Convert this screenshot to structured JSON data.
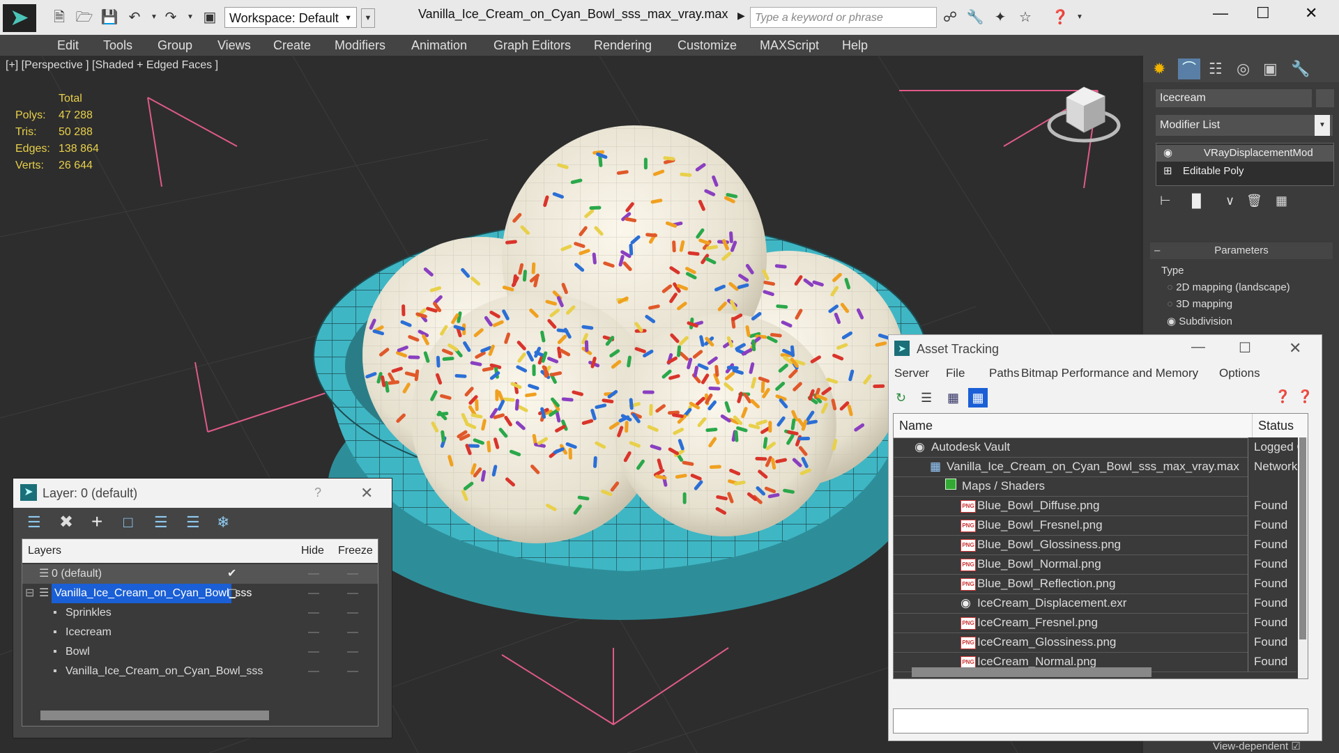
{
  "app": {
    "file_title": "Vanilla_Ice_Cream_on_Cyan_Bowl_sss_max_vray.max",
    "workspace": "Workspace: Default",
    "search_placeholder": "Type a keyword or phrase"
  },
  "menu": [
    "Edit",
    "Tools",
    "Group",
    "Views",
    "Create",
    "Modifiers",
    "Animation",
    "Graph Editors",
    "Rendering",
    "Customize",
    "MAXScript",
    "Help"
  ],
  "viewport": {
    "label": "[+] [Perspective ] [Shaded + Edged Faces ]",
    "stats_header": "Total",
    "stats": [
      {
        "label": "Polys:",
        "value": "47 288"
      },
      {
        "label": "Tris:",
        "value": "50 288"
      },
      {
        "label": "Edges:",
        "value": "138 864"
      },
      {
        "label": "Verts:",
        "value": "26 644"
      }
    ]
  },
  "command_panel": {
    "object_name": "Icecream",
    "modifier_list": "Modifier List",
    "stack": [
      "VRayDisplacementMod",
      "Editable Poly"
    ],
    "rollout_title": "Parameters",
    "type_label": "Type",
    "options": [
      "2D mapping (landscape)",
      "3D mapping",
      "Subdivision"
    ],
    "selected_option": "Subdivision",
    "view_dependent": "View-dependent"
  },
  "layer_dialog": {
    "title": "Layer: 0 (default)",
    "help": "?",
    "columns": {
      "layers": "Layers",
      "hide": "Hide",
      "freeze": "Freeze"
    },
    "rows": [
      {
        "name": "0 (default)",
        "level": 0,
        "type": "layer",
        "selected": false,
        "current": true
      },
      {
        "name": "Vanilla_Ice_Cream_on_Cyan_Bowl_sss",
        "level": 0,
        "type": "layer",
        "selected": true,
        "current": false
      },
      {
        "name": "Sprinkles",
        "level": 1,
        "type": "object",
        "selected": false,
        "current": false
      },
      {
        "name": "Icecream",
        "level": 1,
        "type": "object",
        "selected": false,
        "current": false
      },
      {
        "name": "Bowl",
        "level": 1,
        "type": "object",
        "selected": false,
        "current": false
      },
      {
        "name": "Vanilla_Ice_Cream_on_Cyan_Bowl_sss",
        "level": 1,
        "type": "object",
        "selected": false,
        "current": false
      }
    ]
  },
  "asset_tracking": {
    "title": "Asset Tracking",
    "menu": [
      "Server",
      "File",
      "Paths",
      "Bitmap Performance and Memory",
      "Options"
    ],
    "columns": {
      "name": "Name",
      "status": "Status"
    },
    "rows": [
      {
        "name": "Autodesk Vault",
        "status": "Logged O",
        "level": 0,
        "icon": "vault"
      },
      {
        "name": "Vanilla_Ice_Cream_on_Cyan_Bowl_sss_max_vray.max",
        "status": "Network",
        "level": 1,
        "icon": "max"
      },
      {
        "name": "Maps / Shaders",
        "status": "",
        "level": 2,
        "icon": "maps"
      },
      {
        "name": "Blue_Bowl_Diffuse.png",
        "status": "Found",
        "level": 3,
        "icon": "png"
      },
      {
        "name": "Blue_Bowl_Fresnel.png",
        "status": "Found",
        "level": 3,
        "icon": "png"
      },
      {
        "name": "Blue_Bowl_Glossiness.png",
        "status": "Found",
        "level": 3,
        "icon": "png"
      },
      {
        "name": "Blue_Bowl_Normal.png",
        "status": "Found",
        "level": 3,
        "icon": "png"
      },
      {
        "name": "Blue_Bowl_Reflection.png",
        "status": "Found",
        "level": 3,
        "icon": "png"
      },
      {
        "name": "IceCream_Displacement.exr",
        "status": "Found",
        "level": 3,
        "icon": "exr"
      },
      {
        "name": "IceCream_Fresnel.png",
        "status": "Found",
        "level": 3,
        "icon": "png"
      },
      {
        "name": "IceCream_Glossiness.png",
        "status": "Found",
        "level": 3,
        "icon": "png"
      },
      {
        "name": "IceCream_Normal.png",
        "status": "Found",
        "level": 3,
        "icon": "png"
      }
    ]
  },
  "colors": {
    "accent_blue": "#1a5fd6",
    "bowl_cyan": "#3fb6c4",
    "stats_yellow": "#e8d04a",
    "grid_pink": "#e05a8a"
  }
}
